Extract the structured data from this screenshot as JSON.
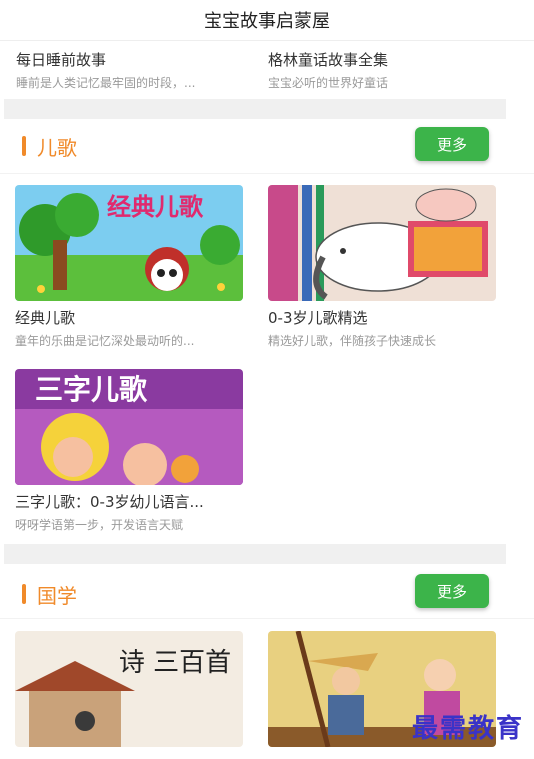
{
  "header": {
    "title": "宝宝故事启蒙屋"
  },
  "top_items": [
    {
      "title": "每日睡前故事",
      "subtitle": "睡前是人类记忆最牢固的时段，..."
    },
    {
      "title": "格林童话故事全集",
      "subtitle": "宝宝必听的世界好童话"
    }
  ],
  "sections": [
    {
      "title": "儿歌",
      "more_label": "更多",
      "items": [
        {
          "title": "经典儿歌",
          "subtitle": "童年的乐曲是记忆深处最动听的...",
          "thumb_text": "经典儿歌"
        },
        {
          "title": "0-3岁儿歌精选",
          "subtitle": "精选好儿歌，伴随孩子快速成长"
        },
        {
          "title": "三字儿歌：0-3岁幼儿语言...",
          "subtitle": "呀呀学语第一步，开发语言天赋",
          "thumb_text": "三字儿歌"
        }
      ]
    },
    {
      "title": "国学",
      "more_label": "更多",
      "items": [
        {
          "title": "",
          "subtitle": "",
          "thumb_text": "诗 三百首"
        },
        {
          "title": "",
          "subtitle": ""
        }
      ]
    }
  ],
  "watermark": "最需教育",
  "colors": {
    "accent": "#f08a2a",
    "button": "#3cb44a",
    "watermark": "#3a33c8"
  }
}
